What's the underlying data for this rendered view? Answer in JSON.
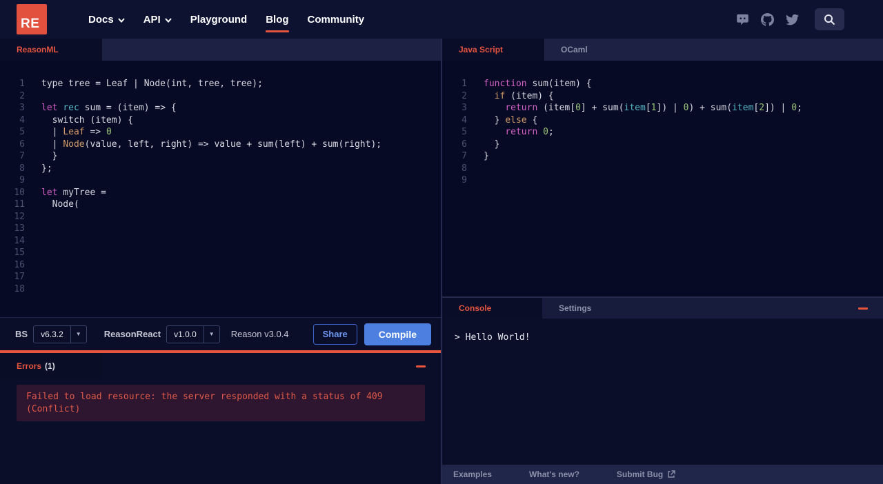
{
  "theme": {
    "accent_red": "#e4543f",
    "logo_red": "#e2503e",
    "compile_blue": "#4d7fe0",
    "error_text": "#e05a48",
    "error_box_bg": "#2e1530",
    "code_magenta": "#d160c4",
    "code_cyan": "#56b6c2",
    "code_orange": "#d19a66",
    "code_green": "#98c379"
  },
  "header": {
    "logo_text": "RE",
    "nav": [
      {
        "label": "Docs",
        "has_dropdown": true,
        "active": false
      },
      {
        "label": "API",
        "has_dropdown": true,
        "active": false
      },
      {
        "label": "Playground",
        "has_dropdown": false,
        "active": false
      },
      {
        "label": "Blog",
        "has_dropdown": false,
        "active": true
      },
      {
        "label": "Community",
        "has_dropdown": false,
        "active": false
      }
    ],
    "icons": [
      "discord-icon",
      "github-icon",
      "twitter-icon",
      "search-icon"
    ]
  },
  "left_panel": {
    "tab": "ReasonML",
    "code": [
      [
        [
          "p",
          "type tree = Leaf | Node(int, tree, tree);"
        ]
      ],
      [],
      [
        [
          "kw",
          "let"
        ],
        [
          "p",
          " "
        ],
        [
          "cy",
          "rec"
        ],
        [
          "p",
          " sum = (item) => {"
        ]
      ],
      [
        [
          "p",
          "  switch (item) {"
        ]
      ],
      [
        [
          "p",
          "  | "
        ],
        [
          "or",
          "Leaf"
        ],
        [
          "p",
          " => "
        ],
        [
          "gr",
          "0"
        ]
      ],
      [
        [
          "p",
          "  | "
        ],
        [
          "or",
          "Node"
        ],
        [
          "p",
          "(value, left, right) => value + sum(left) + sum(right);"
        ]
      ],
      [
        [
          "p",
          "  }"
        ]
      ],
      [
        [
          "p",
          "};"
        ]
      ],
      [],
      [
        [
          "kw",
          "let"
        ],
        [
          "p",
          " myTree ="
        ]
      ],
      [
        [
          "p",
          "  Node("
        ]
      ],
      [],
      [],
      [],
      [],
      [],
      [],
      []
    ],
    "toolbar": {
      "bs_label": "BS",
      "bs_version": "v6.3.2",
      "reasonreact_label": "ReasonReact",
      "reasonreact_version": "v1.0.0",
      "reason_version": "Reason v3.0.4",
      "share_label": "Share",
      "compile_label": "Compile"
    },
    "errors": {
      "tab_label": "Errors",
      "count": "(1)",
      "message": "Failed to load resource: the server responded with a status of 409 (Conflict)"
    }
  },
  "right_panel": {
    "tabs": [
      "Java Script",
      "OCaml"
    ],
    "code": [
      [
        [
          "kw",
          "function"
        ],
        [
          "p",
          " sum(item) {"
        ]
      ],
      [
        [
          "p",
          "  "
        ],
        [
          "or",
          "if"
        ],
        [
          "p",
          " (item) {"
        ]
      ],
      [
        [
          "p",
          "    "
        ],
        [
          "kw",
          "return"
        ],
        [
          "p",
          " (item["
        ],
        [
          "gr",
          "0"
        ],
        [
          "p",
          "] + sum("
        ],
        [
          "cy",
          "item"
        ],
        [
          "p",
          "["
        ],
        [
          "gr",
          "1"
        ],
        [
          "p",
          "]) | "
        ],
        [
          "gr",
          "0"
        ],
        [
          "p",
          ") + sum("
        ],
        [
          "cy",
          "item"
        ],
        [
          "p",
          "["
        ],
        [
          "gr",
          "2"
        ],
        [
          "p",
          "]) | "
        ],
        [
          "gr",
          "0"
        ],
        [
          "p",
          ";"
        ]
      ],
      [
        [
          "p",
          "  } "
        ],
        [
          "or",
          "else"
        ],
        [
          "p",
          " {"
        ]
      ],
      [
        [
          "p",
          "    "
        ],
        [
          "kw",
          "return"
        ],
        [
          "p",
          " "
        ],
        [
          "gr",
          "0"
        ],
        [
          "p",
          ";"
        ]
      ],
      [
        [
          "p",
          "  }"
        ]
      ],
      [
        [
          "p",
          "}"
        ]
      ],
      [],
      []
    ],
    "console": {
      "tabs": [
        "Console",
        "Settings"
      ],
      "output": "> Hello World!"
    },
    "footer": [
      "Examples",
      "What's new?",
      "Submit Bug"
    ]
  }
}
